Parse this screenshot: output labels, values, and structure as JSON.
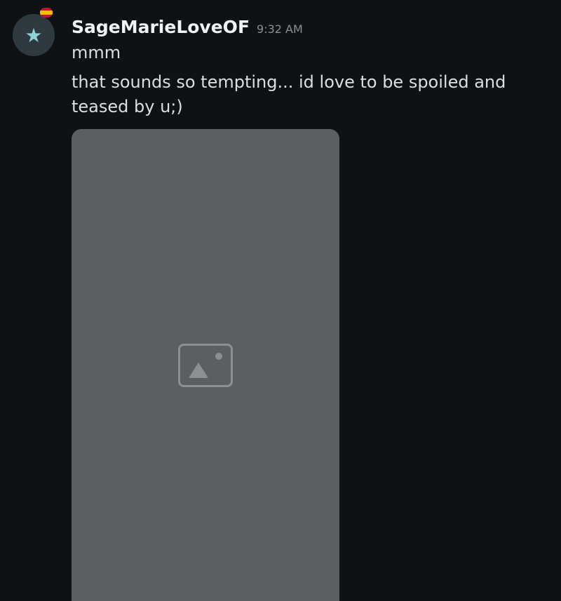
{
  "message": {
    "username": "SageMarieLoveOF",
    "timestamp": "9:32 AM",
    "lines": [
      "mmm",
      "that sounds so tempting... id love to be spoiled and teased by u;)"
    ]
  },
  "avatar": {
    "icon": "cartoon-avatar-icon",
    "badge": "spain-flag-icon"
  },
  "colors": {
    "background": "#0e1215",
    "username": "#f2f3f5",
    "text": "#dcdee1",
    "timestamp": "#8a8f95"
  }
}
